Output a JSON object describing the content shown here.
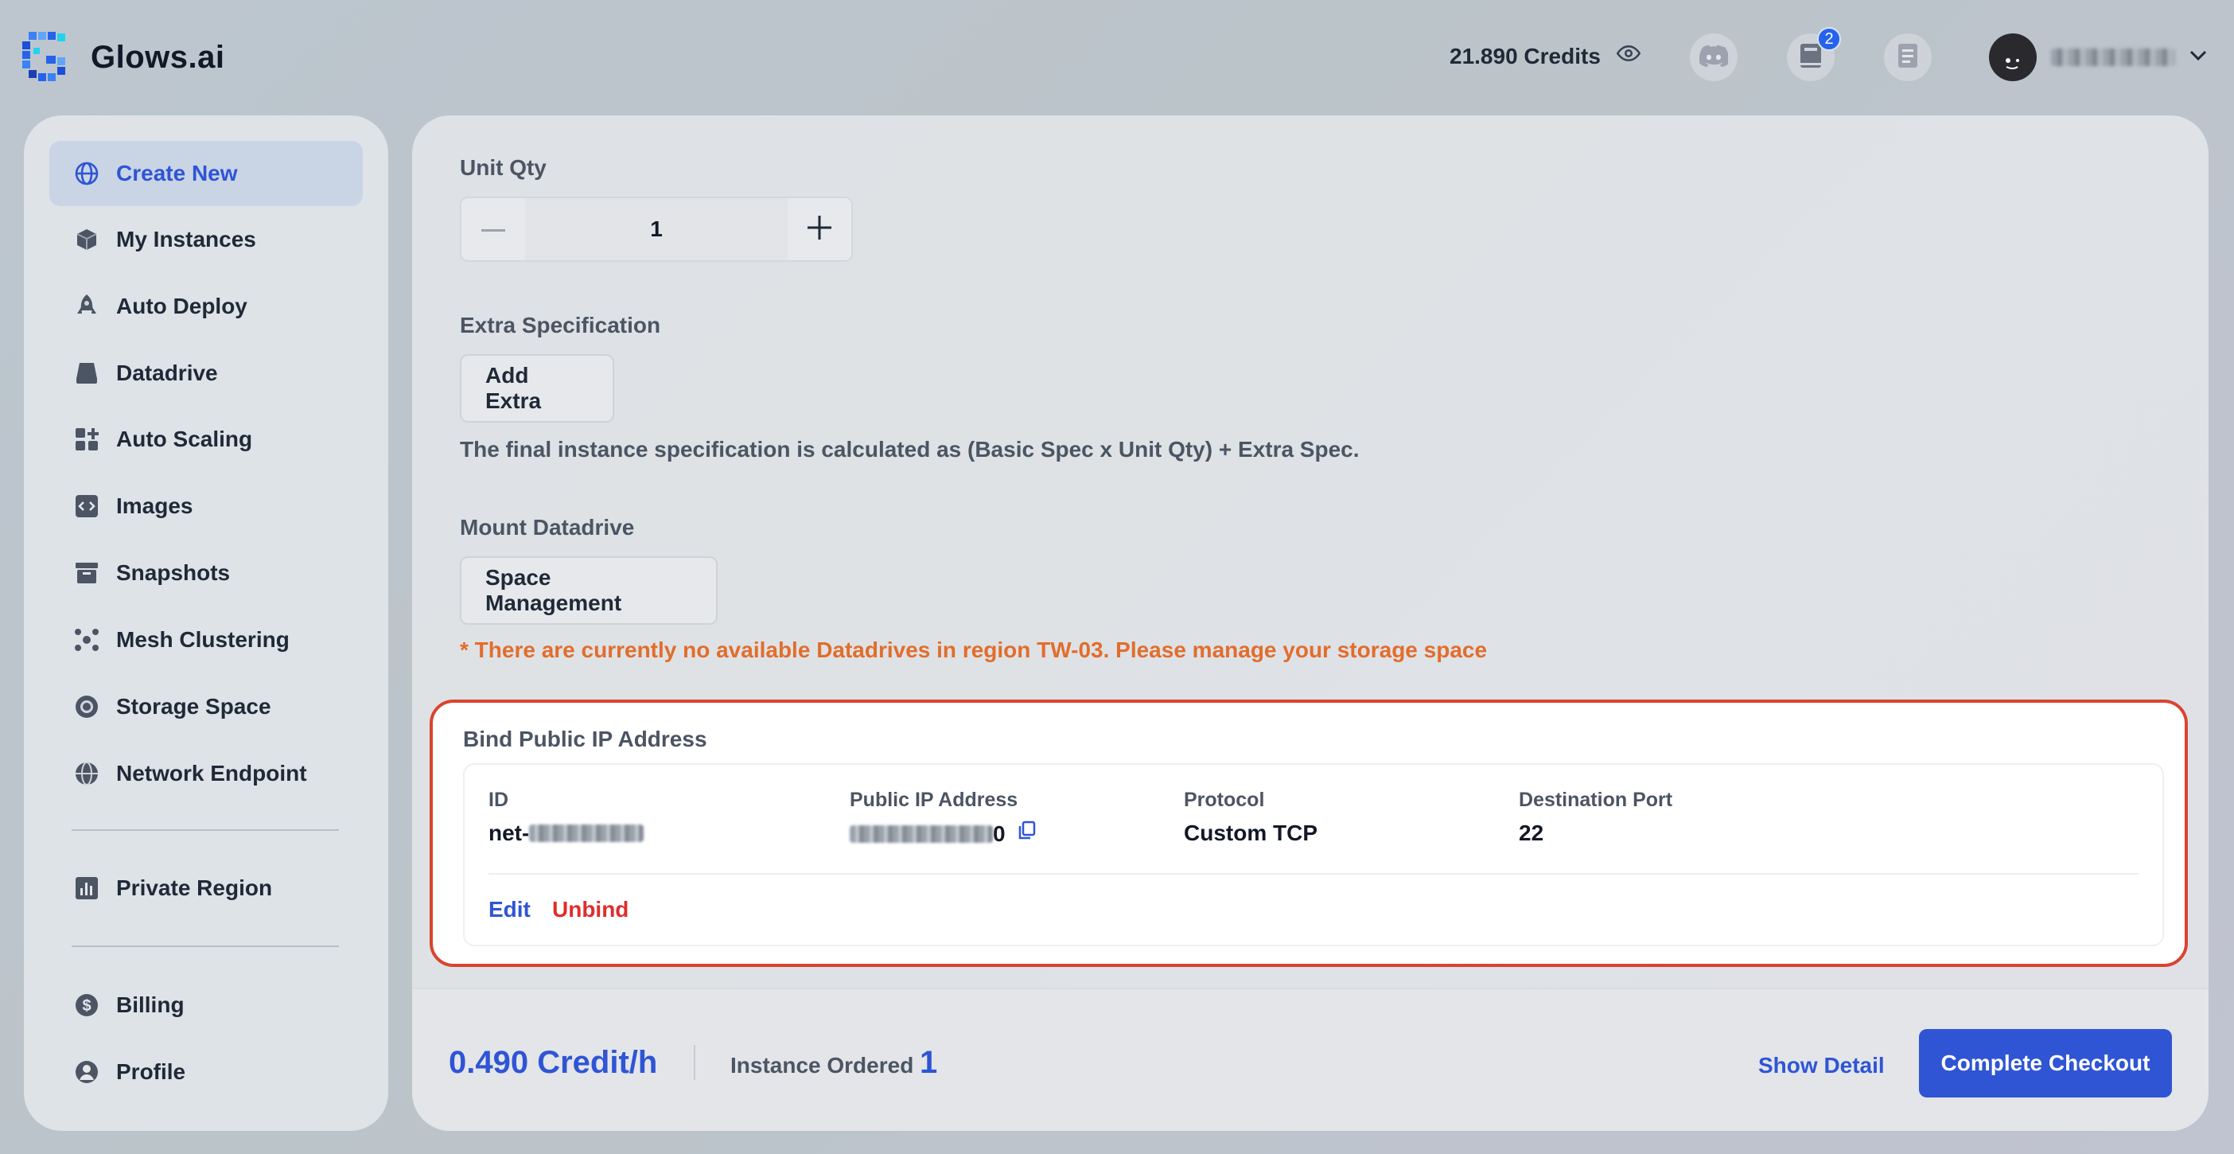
{
  "app": {
    "name": "Glows.ai"
  },
  "header": {
    "credits_label": "21.890 Credits",
    "notification_count": "2"
  },
  "sidebar": {
    "items": [
      {
        "label": "Create New",
        "icon": "globe-icon",
        "active": true
      },
      {
        "label": "My Instances",
        "icon": "cube-icon"
      },
      {
        "label": "Auto Deploy",
        "icon": "rocket-icon"
      },
      {
        "label": "Datadrive",
        "icon": "drive-icon"
      },
      {
        "label": "Auto Scaling",
        "icon": "grid-plus-icon"
      },
      {
        "label": "Images",
        "icon": "code-icon"
      },
      {
        "label": "Snapshots",
        "icon": "archive-icon"
      },
      {
        "label": "Mesh Clustering",
        "icon": "cluster-icon"
      },
      {
        "label": "Storage Space",
        "icon": "storage-icon"
      },
      {
        "label": "Network Endpoint",
        "icon": "network-globe-icon"
      },
      {
        "label": "Private Region",
        "icon": "bar-chart-icon"
      },
      {
        "label": "Billing",
        "icon": "dollar-icon"
      },
      {
        "label": "Profile",
        "icon": "user-icon"
      }
    ]
  },
  "form": {
    "unit_qty_label": "Unit Qty",
    "unit_qty_value": "1",
    "extra_spec_label": "Extra Specification",
    "add_extra_label": "Add Extra",
    "spec_note": "The final instance specification is calculated as (Basic Spec x Unit Qty) + Extra Spec.",
    "mount_label": "Mount Datadrive",
    "space_mgmt_label": "Space Management",
    "warning": "* There are currently no available Datadrives in region TW-03. Please manage your storage space"
  },
  "bind_ip": {
    "title": "Bind Public IP Address",
    "headers": {
      "id": "ID",
      "ip": "Public IP Address",
      "protocol": "Protocol",
      "port": "Destination Port"
    },
    "row": {
      "id_prefix": "net-",
      "ip_suffix": "0",
      "protocol": "Custom TCP",
      "port": "22"
    },
    "edit_label": "Edit",
    "unbind_label": "Unbind"
  },
  "footer": {
    "price": "0.490 Credit/h",
    "ordered_label": "Instance Ordered",
    "ordered_value": "1",
    "show_detail_label": "Show Detail",
    "checkout_label": "Complete Checkout"
  },
  "colors": {
    "accent": "#2f55d4",
    "warning": "#e26d2c",
    "danger": "#e02d2d",
    "highlight_border": "#d9442f"
  }
}
